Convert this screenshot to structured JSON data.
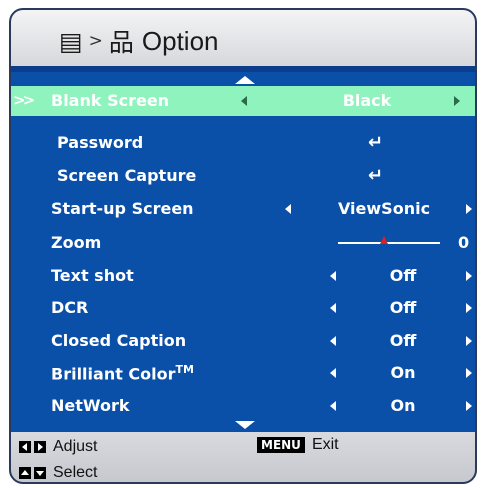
{
  "header": {
    "breadcrumb_sep": ">",
    "title": "Option",
    "icons": [
      "menu-list-icon",
      "network-tree-icon"
    ]
  },
  "rows": [
    {
      "label": "Blank Screen",
      "value": "Black",
      "type": "select",
      "selected": true
    },
    {
      "label": "Password",
      "type": "enter"
    },
    {
      "label": "Screen Capture",
      "type": "enter"
    },
    {
      "label": "Start-up Screen",
      "value": "ViewSonic",
      "type": "select"
    },
    {
      "label": "Zoom",
      "value": "0",
      "type": "slider",
      "level": 0.45
    },
    {
      "label": "Text shot",
      "value": "Off",
      "type": "select"
    },
    {
      "label": "DCR",
      "value": "Off",
      "type": "select"
    },
    {
      "label": "Closed Caption",
      "value": "Off",
      "type": "select"
    },
    {
      "label": "Brilliant Color",
      "label_sup": "TM",
      "value": "On",
      "type": "select"
    },
    {
      "label": "NetWork",
      "value": "On",
      "type": "select"
    }
  ],
  "footer": {
    "adjust": "Adjust",
    "exit_key": "MENU",
    "exit": "Exit",
    "select": "Select"
  },
  "colors": {
    "background": "#0a4fa8",
    "selected_row": "#8ff3be",
    "slider_thumb": "#e02020"
  },
  "enter_symbol": "↵",
  "pointer_symbol": ">>"
}
